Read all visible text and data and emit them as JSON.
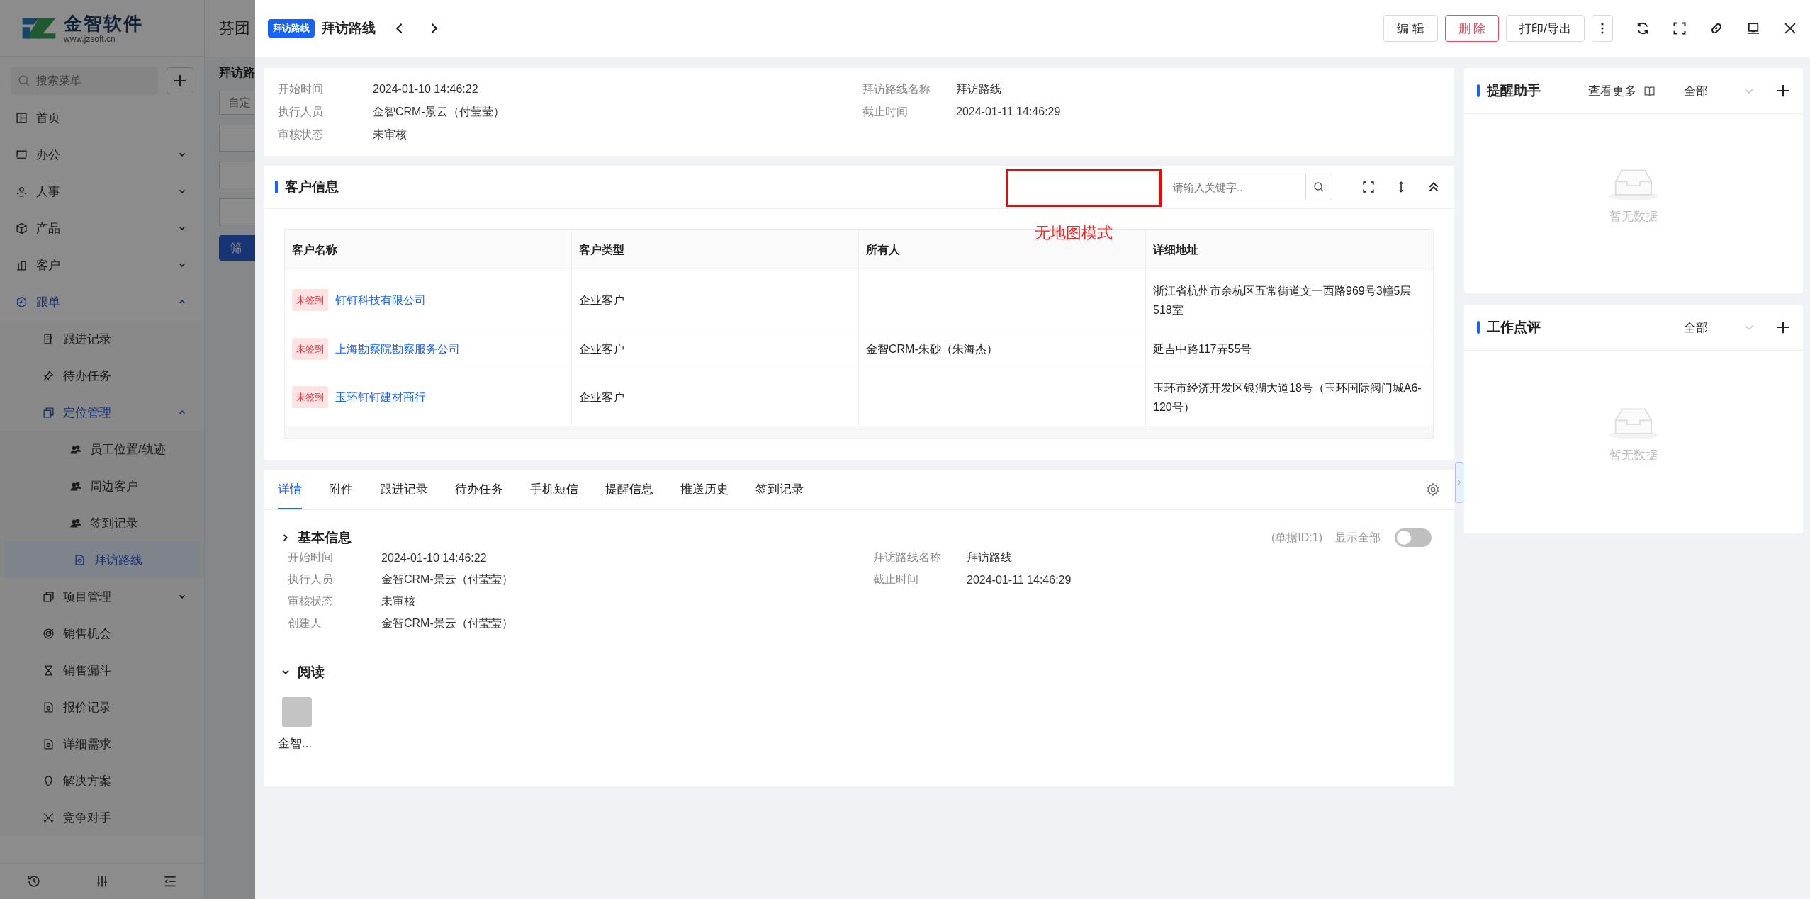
{
  "app": {
    "logo_name": "金智软件",
    "logo_url": "www.jzsoft.cn",
    "search_placeholder": "搜索菜单",
    "header_title": "芬团",
    "page_title": "拜访路",
    "filter_placeholder": "自定",
    "filter_button": "筛"
  },
  "sidebar": {
    "items": [
      {
        "label": "首页",
        "selected": false
      },
      {
        "label": "办公",
        "selected": false,
        "expanded": false
      },
      {
        "label": "人事",
        "selected": false,
        "expanded": false
      },
      {
        "label": "产品",
        "selected": false,
        "expanded": false
      },
      {
        "label": "客户",
        "selected": false,
        "expanded": false
      },
      {
        "label": "跟单",
        "selected": false,
        "expanded": true,
        "children": [
          {
            "label": "跟进记录",
            "selected": false
          },
          {
            "label": "待办任务",
            "selected": false
          },
          {
            "label": "定位管理",
            "selected": false,
            "expanded": true,
            "children": [
              {
                "label": "员工位置/轨迹",
                "selected": false
              },
              {
                "label": "周边客户",
                "selected": false
              },
              {
                "label": "签到记录",
                "selected": false
              },
              {
                "label": "拜访路线",
                "selected": true
              }
            ]
          },
          {
            "label": "项目管理",
            "selected": false,
            "expanded": false
          },
          {
            "label": "销售机会",
            "selected": false
          },
          {
            "label": "销售漏斗",
            "selected": false
          },
          {
            "label": "报价记录",
            "selected": false
          },
          {
            "label": "详细需求",
            "selected": false
          },
          {
            "label": "解决方案",
            "selected": false
          },
          {
            "label": "竞争对手",
            "selected": false
          }
        ]
      }
    ]
  },
  "drawer": {
    "tag": "拜访路线",
    "title": "拜访路线",
    "buttons": [
      {
        "label": "编 辑",
        "kind": "default"
      },
      {
        "label": "删 除",
        "kind": "danger"
      },
      {
        "label": "打印/导出",
        "kind": "default"
      }
    ]
  },
  "summary": {
    "left": [
      {
        "label": "开始时间",
        "value": "2024-01-10 14:46:22"
      },
      {
        "label": "执行人员",
        "value": "金智CRM-景云（付莹莹）"
      },
      {
        "label": "审核状态",
        "value": "未审核"
      }
    ],
    "right": [
      {
        "label": "拜访路线名称",
        "value": "拜访路线"
      },
      {
        "label": "截止时间",
        "value": "2024-01-11 14:46:29"
      }
    ]
  },
  "customers": {
    "title": "客户信息",
    "search_placeholder": "请输入关键字...",
    "annotation": "无地图模式",
    "columns": [
      "客户名称",
      "客户类型",
      "所有人",
      "详细地址"
    ],
    "rows": [
      {
        "status": "未签到",
        "name": "钉钉科技有限公司",
        "type": "企业客户",
        "address": "浙江省杭州市余杭区五常街道文一西路969号3幢5层518室"
      },
      {
        "status": "未签到",
        "name": "上海勘察院勘察服务公司",
        "type": "企业客户",
        "owner": "金智CRM-朱砂（朱海杰）",
        "address": "延吉中路117弄55号"
      },
      {
        "status": "未签到",
        "name": "玉环钉钉建材商行",
        "type": "企业客户",
        "address": "玉环市经济开发区银湖大道18号（玉环国际阀门城A6-120号）"
      }
    ]
  },
  "detail": {
    "tabs": [
      {
        "label": "详情",
        "selected": true
      },
      {
        "label": "附件",
        "selected": false
      },
      {
        "label": "跟进记录",
        "selected": false
      },
      {
        "label": "待办任务",
        "selected": false
      },
      {
        "label": "手机短信",
        "selected": false
      },
      {
        "label": "提醒信息",
        "selected": false
      },
      {
        "label": "推送历史",
        "selected": false
      },
      {
        "label": "签到记录",
        "selected": false
      }
    ],
    "section": {
      "title": "基本信息",
      "expanded": false,
      "doc_id": "(单据ID:1)",
      "show_all": {
        "label": "显示全部",
        "on": false
      },
      "left": [
        {
          "label": "开始时间",
          "value": "2024-01-10 14:46:22"
        },
        {
          "label": "执行人员",
          "value": "金智CRM-景云（付莹莹）"
        },
        {
          "label": "审核状态",
          "value": "未审核"
        },
        {
          "label": "创建人",
          "value": "金智CRM-景云（付莹莹）"
        }
      ],
      "right": [
        {
          "label": "拜访路线名称",
          "value": "拜访路线"
        },
        {
          "label": "截止时间",
          "value": "2024-01-11 14:46:29"
        }
      ]
    },
    "readers": {
      "title": "阅读",
      "expanded": true,
      "people": [
        {
          "name": "金智..."
        }
      ]
    }
  },
  "panels": [
    {
      "title": "提醒助手",
      "more": "查看更多",
      "filter": "全部",
      "empty": "暂无数据"
    },
    {
      "title": "工作点评",
      "filter": "全部",
      "empty": "暂无数据"
    }
  ]
}
